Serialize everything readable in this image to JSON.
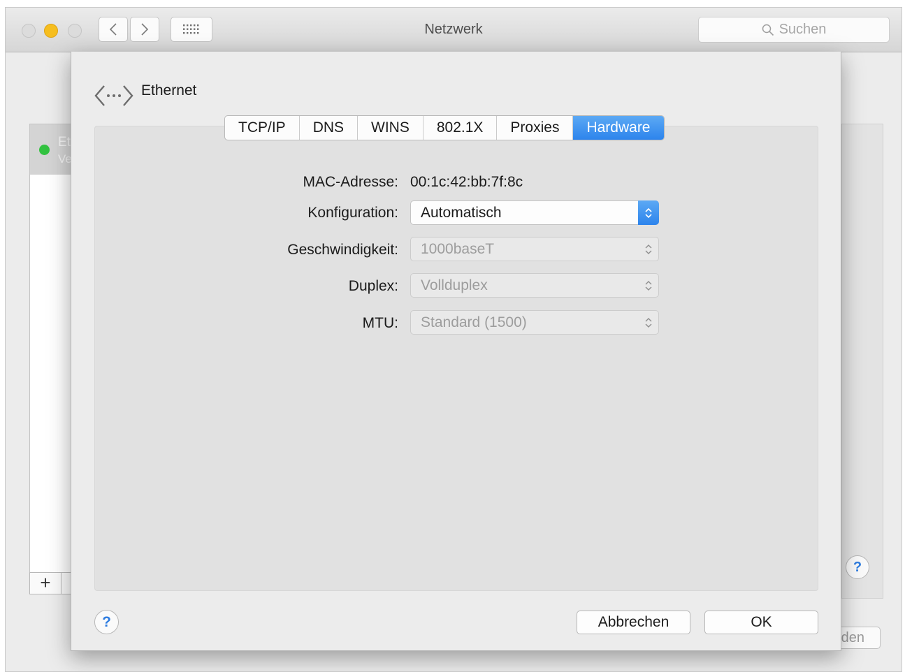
{
  "window": {
    "title": "Netzwerk",
    "search_placeholder": "Suchen",
    "nav_icons": [
      "back-chevron-icon",
      "forward-chevron-icon",
      "grid-icon"
    ]
  },
  "background": {
    "selected_service_name_partial": "Et",
    "selected_service_status_partial": "Ve",
    "status_color": "#32c240",
    "add_label": "+",
    "help_label": "?",
    "button_partial": "den"
  },
  "sheet": {
    "service_title": "Ethernet",
    "service_icon": "ethernet-arrows-icon",
    "tabs": [
      {
        "label": "TCP/IP",
        "active": false
      },
      {
        "label": "DNS",
        "active": false
      },
      {
        "label": "WINS",
        "active": false
      },
      {
        "label": "802.1X",
        "active": false
      },
      {
        "label": "Proxies",
        "active": false
      },
      {
        "label": "Hardware",
        "active": true
      }
    ],
    "fields": {
      "mac": {
        "label": "MAC-Adresse:",
        "value": "00:1c:42:bb:7f:8c"
      },
      "config": {
        "label": "Konfiguration:",
        "value": "Automatisch",
        "enabled": true
      },
      "speed": {
        "label": "Geschwindigkeit:",
        "value": "1000baseT",
        "enabled": false
      },
      "duplex": {
        "label": "Duplex:",
        "value": "Vollduplex",
        "enabled": false
      },
      "mtu": {
        "label": "MTU:",
        "value": "Standard (1500)",
        "enabled": false
      }
    },
    "help_label": "?",
    "cancel_label": "Abbrechen",
    "ok_label": "OK"
  },
  "colors": {
    "accent": "#2d84ec",
    "minimize": "#f6be1f"
  }
}
